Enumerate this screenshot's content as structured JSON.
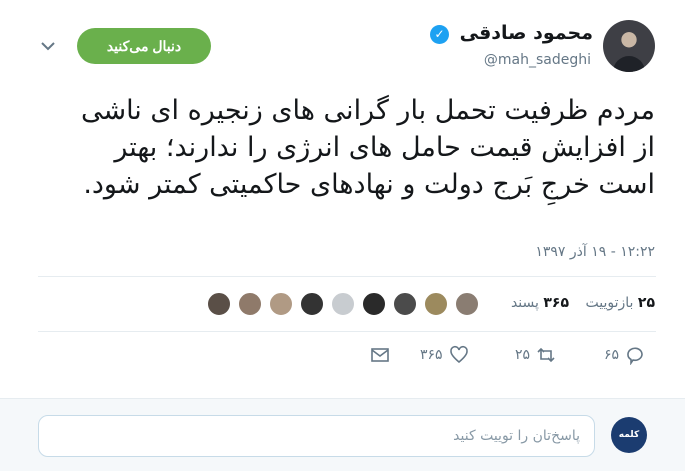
{
  "user": {
    "display_name": "محمود صادقی",
    "handle": "@mah_sadeghi",
    "verified_icon": "verified-badge-icon"
  },
  "header": {
    "follow_label": "دنبال می‌کنید",
    "follow_color": "#6ab04c"
  },
  "tweet": {
    "text": "مردم ظرفیت تحمل بار گرانی های زنجیره ای ناشی از افزایش قیمت حامل های انرژی را ندارند؛ بهتر است خرجِ بَرج دولت و نهادهای حاکمیتی کمتر شود.",
    "timestamp": "۱۲:۲۲ - ۱۹ آذر ۱۳۹۷"
  },
  "stats": {
    "retweets_count": "۲۵",
    "retweets_label": "بازتوییت",
    "likes_count": "۳۶۵",
    "likes_label": "پسند"
  },
  "liker_avatars": [
    {
      "color": "#8a7d72"
    },
    {
      "color": "#9c8a5e"
    },
    {
      "color": "#4b4b4b"
    },
    {
      "color": "#2a2a2a"
    },
    {
      "color": "#c8ccd0"
    },
    {
      "color": "#333333"
    },
    {
      "color": "#b09a84"
    },
    {
      "color": "#8f7a6a"
    },
    {
      "color": "#5a4f47"
    }
  ],
  "actions": {
    "reply_count": "۶۵",
    "retweet_count": "۲۵",
    "like_count": "۳۶۵"
  },
  "reply_box": {
    "placeholder": "پاسخ‌تان را توییت کنید",
    "my_avatar_text": "کلمه"
  },
  "colors": {
    "accent": "#1da1f2",
    "muted": "#657786"
  }
}
